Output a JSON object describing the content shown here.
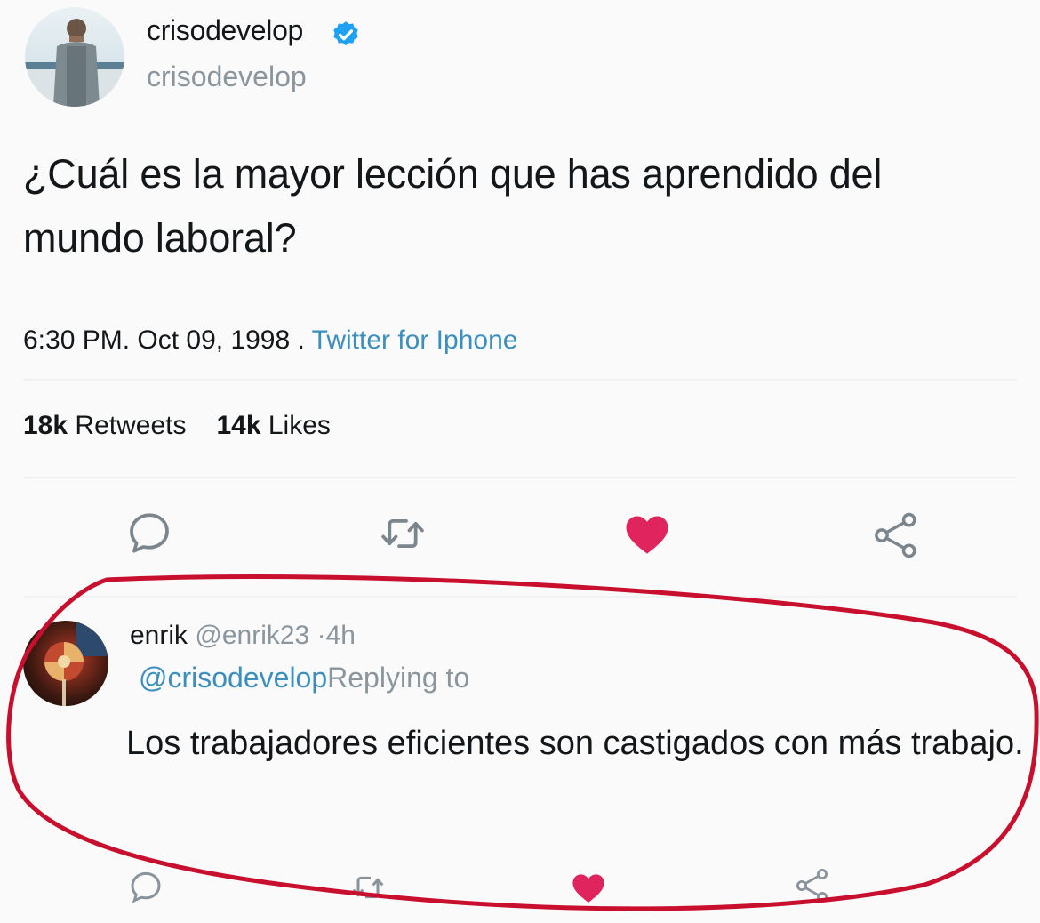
{
  "tweet": {
    "author_name": "crisodevelop",
    "author_handle": "crisodevelop",
    "text": "¿Cuál es la mayor lección que has aprendido del mundo laboral?",
    "timestamp": "6:30 PM. Oct 09, 1998",
    "separator": " . ",
    "source": "Twitter for Iphone",
    "retweets_count": "18k",
    "retweets_label": "Retweets",
    "likes_count": "14k",
    "likes_label": "Likes"
  },
  "reply": {
    "author_name": "enrik",
    "author_handle": "@enrik23",
    "time": "·4h",
    "mention": "@crisodevelop",
    "replying_label": "Replying to",
    "text": "Los trabajadores eficientes son castigados con más trabajo."
  },
  "colors": {
    "like_heart": "#e0245e",
    "link_blue": "#3a8fbf",
    "verified_blue": "#1da1f2",
    "annotation_red": "#c8102e"
  },
  "icons": [
    "verified-icon",
    "reply-icon",
    "retweet-icon",
    "heart-icon",
    "share-icon"
  ]
}
